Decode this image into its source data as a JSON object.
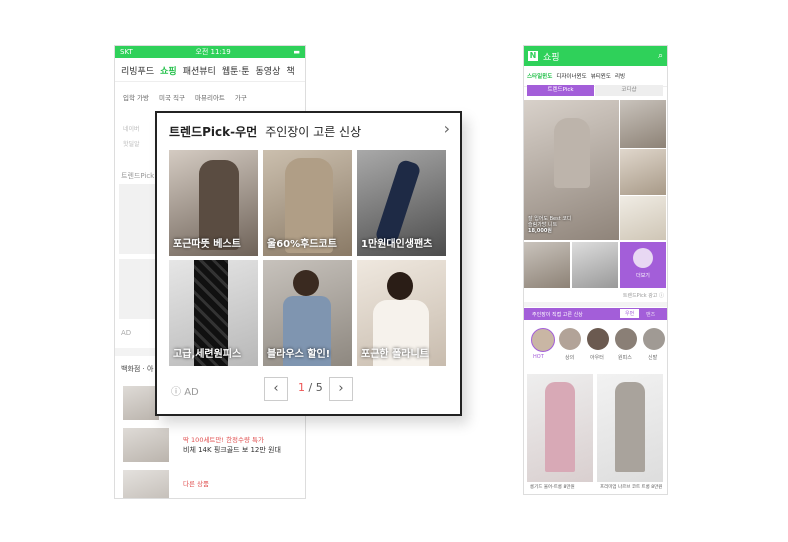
{
  "left_phone": {
    "status": {
      "carrier": "SKT",
      "time": "오전 11:19"
    },
    "tabs": [
      "리빙푸드",
      "쇼핑",
      "패션뷰티",
      "웹툰·툰",
      "동영상",
      "책"
    ],
    "active_tab": "쇼핑",
    "categories": [
      "입학 가방",
      "미국 직구",
      "마뮤리아트",
      "가구"
    ],
    "ghost_texts": [
      "네이버",
      "핫딜알",
      "트렌드Pick"
    ],
    "section_label": "백화점 · 아",
    "promo_line1": "딱 100세트만! 한정수량 특가",
    "promo_line2": "비체 14K 핑크골드 보 12만 원대",
    "promo_line3": "다른 상품",
    "ad_label": "AD"
  },
  "popup": {
    "title": "트렌드Pick-우먼",
    "subtitle": "주인장이 고른 신상",
    "tiles": [
      {
        "caption": "포근따뜻 베스트"
      },
      {
        "caption": "울60%후드코트"
      },
      {
        "caption": "1만원대인생팬츠"
      },
      {
        "caption": "고급,세련원피스"
      },
      {
        "caption": "블라우스 할인!"
      },
      {
        "caption": "포근한 폴라니트"
      }
    ],
    "ad_label": "AD",
    "page_current": "1",
    "page_total": "/ 5",
    "prev_symbol": "‹",
    "next_symbol": "›"
  },
  "right_phone": {
    "logo": "N",
    "title": "쇼핑",
    "tabs": [
      "스타일윈도",
      "디자이너윈도",
      "뷰티윈도",
      "리빙"
    ],
    "active_tab": "스타일윈도",
    "segments": [
      "트렌드Pick",
      "코디샵"
    ],
    "hero_caption_1": "잘 입어도 Best 코디",
    "hero_caption_2": "슬림가방 니트",
    "hero_price": "18,000원",
    "badge_label": "더보기",
    "ad_line": "트렌드Pick 광고 ⓘ",
    "banner": "주인장이 직접 고른 신상",
    "chip_left": "우먼",
    "chip_right": "맨즈",
    "circles": [
      "HOT",
      "상의",
      "아우터",
      "원피스",
      "신발"
    ],
    "products": [
      "롱기드 울어-트롱 8만원",
      "프리미엄 나르브 코트 트롱 8만원"
    ]
  }
}
